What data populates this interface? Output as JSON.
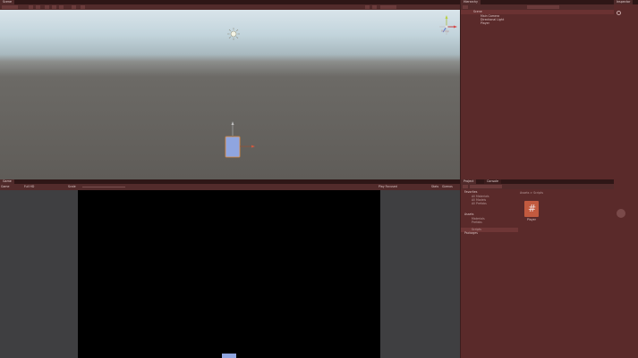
{
  "scene": {
    "tab": "Scene",
    "persp_label": "Persp"
  },
  "game": {
    "tab": "Game",
    "display": "Game",
    "resolution": "Full HD",
    "scale_label": "Scale",
    "play_mode": "Play Focused",
    "stats": "Stats",
    "gizmos": "Gizmos"
  },
  "hierarchy": {
    "tab": "Hierarchy",
    "scene_name": "Scene",
    "items": [
      "Main Camera",
      "Directional Light",
      "Player"
    ]
  },
  "inspector": {
    "tab": "Inspector"
  },
  "project": {
    "tabs": [
      "Project",
      "Console"
    ],
    "favorites": "Favorites",
    "favorite_items": [
      "All Materials",
      "All Models",
      "All Prefabs"
    ],
    "assets": "Assets",
    "asset_folders": [
      "Materials",
      "Prefabs",
      "Scripts"
    ],
    "packages": "Packages",
    "breadcrumb": "Assets > Scripts",
    "file_name": "Player"
  },
  "colors": {
    "accent": "#7c8fd4",
    "bg": "#452626",
    "tab": "#2e1616"
  }
}
